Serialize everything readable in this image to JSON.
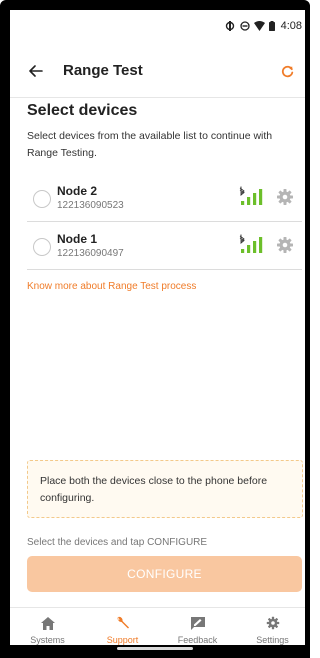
{
  "status_bar": {
    "time": "4:08"
  },
  "app_bar": {
    "title": "Range Test"
  },
  "content": {
    "title": "Select devices",
    "description": "Select devices from the available list to continue with Range Testing.",
    "devices": [
      {
        "name": "Node 2",
        "id": "122136090523",
        "signal_bars": 4
      },
      {
        "name": "Node 1",
        "id": "122136090497",
        "signal_bars": 4
      }
    ],
    "know_more_link": "Know more about Range Test process",
    "info_box": "Place both the devices close to the phone before configuring.",
    "hint": "Select the devices and tap CONFIGURE",
    "configure_label": "CONFIGURE"
  },
  "bottom_nav": [
    {
      "label": "Systems",
      "icon": "home-icon",
      "active": false
    },
    {
      "label": "Support",
      "icon": "wrench-icon",
      "active": true
    },
    {
      "label": "Feedback",
      "icon": "feedback-icon",
      "active": false
    },
    {
      "label": "Settings",
      "icon": "gear-icon",
      "active": false
    }
  ],
  "colors": {
    "accent": "#f07c29",
    "signal": "#6cbf2a",
    "button_disabled": "#f9c7a0"
  }
}
